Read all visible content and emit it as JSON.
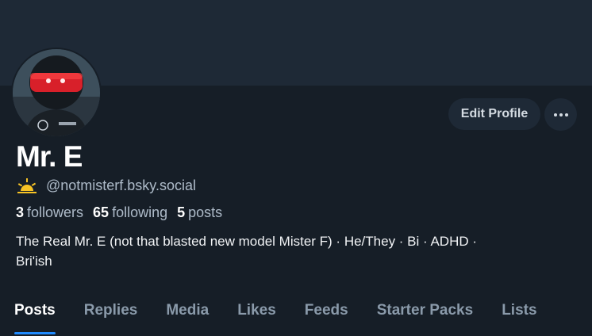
{
  "profile": {
    "display_name": "Mr. E",
    "handle": "@notmisterf.bsky.social",
    "handle_icon": "sun-icon",
    "followers_count": "3",
    "followers_label": "followers",
    "following_count": "65",
    "following_label": "following",
    "posts_count": "5",
    "posts_label": "posts",
    "bio_line1": "The Real Mr. E (not that blasted new model Mister F) · He/They · Bi · ADHD ·",
    "bio_line2": "Bri'ish"
  },
  "actions": {
    "edit_profile_label": "Edit Profile",
    "more_icon": "ellipsis-icon"
  },
  "tabs": [
    {
      "label": "Posts",
      "active": true
    },
    {
      "label": "Replies",
      "active": false
    },
    {
      "label": "Media",
      "active": false
    },
    {
      "label": "Likes",
      "active": false
    },
    {
      "label": "Feeds",
      "active": false
    },
    {
      "label": "Starter Packs",
      "active": false
    },
    {
      "label": "Lists",
      "active": false
    }
  ],
  "colors": {
    "background": "#161e27",
    "banner": "#1e2936",
    "accent": "#208bfe",
    "muted_text": "#aebbc9"
  }
}
